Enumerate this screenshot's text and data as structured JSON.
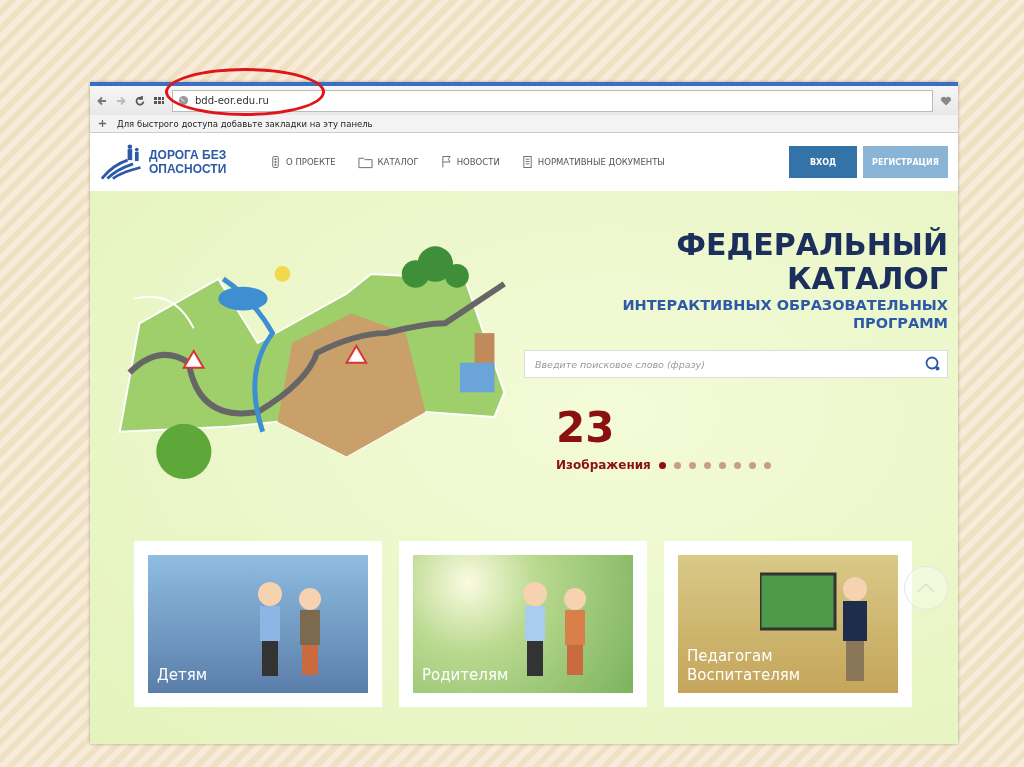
{
  "browser": {
    "url": "bdd-eor.edu.ru",
    "bookmarks_hint": "Для быстрого доступа добавьте закладки на эту панель"
  },
  "header": {
    "logo_lines": [
      "ДОРОГА БЕЗ",
      "ОПАСНОСТИ"
    ],
    "nav": [
      {
        "label": "О ПРОЕКТЕ",
        "kind": "traffic-light"
      },
      {
        "label": "КАТАЛОГ",
        "kind": "folder"
      },
      {
        "label": "НОВОСТИ",
        "kind": "flag"
      },
      {
        "label": "НОРМАТИВНЫЕ ДОКУМЕНТЫ",
        "kind": "document"
      }
    ],
    "buttons": [
      {
        "label": "ВХОД",
        "kind": "primary"
      },
      {
        "label": "РЕГИСТРАЦИЯ",
        "kind": "secondary"
      }
    ]
  },
  "hero": {
    "title_lines": [
      "ФЕДЕРАЛЬНЫЙ",
      "КАТАЛОГ"
    ],
    "subtitle_lines": [
      "ИНТЕРАКТИВНЫХ ОБРАЗОВАТЕЛЬНЫХ",
      "ПРОГРАММ"
    ],
    "search": {
      "placeholder": "Введите поисковое слово (фразу)"
    },
    "counter": "23",
    "counter_label": "Изображения",
    "dots": [
      {
        "selected": true
      },
      {
        "selected": false
      },
      {
        "selected": false
      },
      {
        "selected": false
      },
      {
        "selected": false
      },
      {
        "selected": false
      },
      {
        "selected": false
      },
      {
        "selected": false
      }
    ]
  },
  "cards": [
    {
      "kind": "children",
      "lines": [
        "Детям"
      ]
    },
    {
      "kind": "parents",
      "lines": [
        "Родителям"
      ]
    },
    {
      "kind": "teachers",
      "lines": [
        "Педагогам",
        "Воспитателям"
      ]
    }
  ]
}
